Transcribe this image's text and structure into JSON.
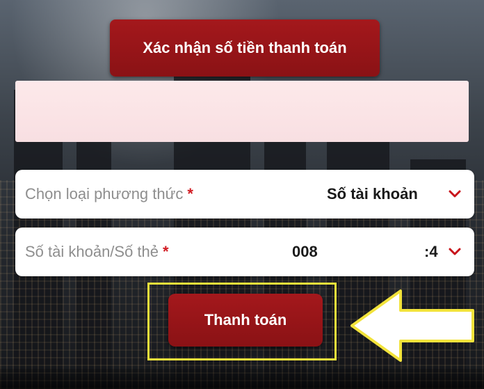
{
  "header": {
    "title": "Xác nhận số tiền thanh toán"
  },
  "amount": {
    "value": ""
  },
  "fields": [
    {
      "label": "Chọn loại phương thức",
      "required_mark": "*",
      "value": "Số tài khoản",
      "icon": "chevron-down-icon"
    },
    {
      "label": "Số tài khoản/Số thẻ",
      "required_mark": "*",
      "value_start": "008",
      "value_end": ":4",
      "icon": "chevron-down-icon"
    }
  ],
  "actions": {
    "pay_label": "Thanh toán"
  },
  "colors": {
    "brand_red": "#9c151a",
    "required_red": "#d11b22",
    "highlight_yellow": "#f2e33b",
    "arrow_white": "#ffffff"
  }
}
